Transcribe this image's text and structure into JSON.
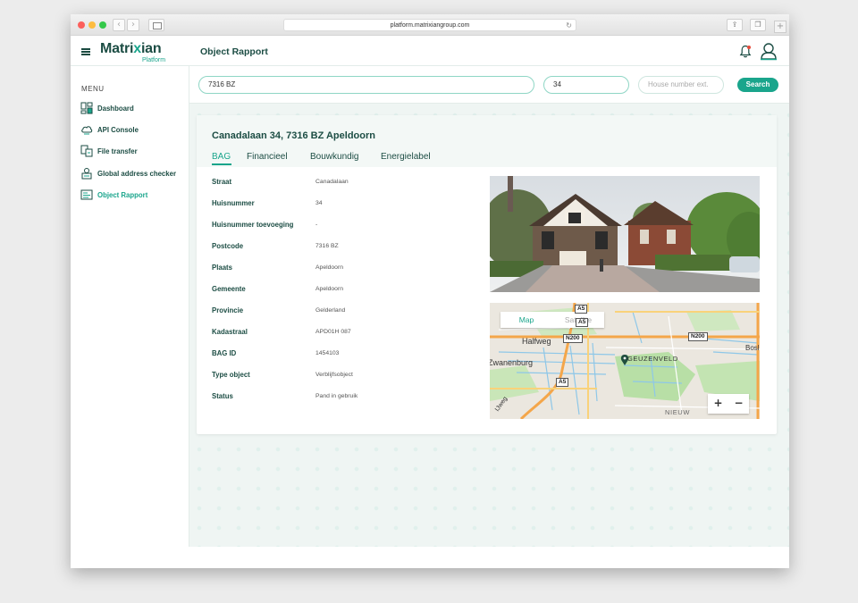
{
  "browser": {
    "url": "platform.matrixiangroup.com"
  },
  "app": {
    "logo_main_a": "Matri",
    "logo_main_x": "x",
    "logo_main_b": "ian",
    "logo_sub": "Platform",
    "page_title": "Object Rapport"
  },
  "sidebar": {
    "menu_label": "MENU",
    "items": [
      {
        "label": "Dashboard",
        "icon": "dashboard-icon"
      },
      {
        "label": "API Console",
        "icon": "cloud-icon"
      },
      {
        "label": "File transfer",
        "icon": "file-transfer-icon"
      },
      {
        "label": "Global address checker",
        "icon": "address-checker-icon"
      },
      {
        "label": "Object Rapport",
        "icon": "report-icon",
        "active": true
      }
    ]
  },
  "search": {
    "postcode_value": "7316 BZ",
    "house_number_value": "34",
    "extension_placeholder": "House number ext.",
    "button_label": "Search"
  },
  "report": {
    "address": "Canadalaan 34, 7316 BZ Apeldoorn",
    "tabs": [
      "BAG",
      "Financieel",
      "Bouwkundig",
      "Energielabel"
    ],
    "active_tab": "BAG",
    "fields": [
      {
        "label": "Straat",
        "value": "Canadalaan"
      },
      {
        "label": "Huisnummer",
        "value": "34"
      },
      {
        "label": "Huisnummer toevoeging",
        "value": "-"
      },
      {
        "label": "Postcode",
        "value": "7316 BZ"
      },
      {
        "label": "Plaats",
        "value": "Apeldoorn"
      },
      {
        "label": "Gemeente",
        "value": "Apeldoorn"
      },
      {
        "label": "Provincie",
        "value": "Gelderland"
      },
      {
        "label": "Kadastraal",
        "value": "APD01H 087"
      },
      {
        "label": "BAG ID",
        "value": "1454103"
      },
      {
        "label": "Type object",
        "value": "Verblijfsobject"
      },
      {
        "label": "Status",
        "value": "Pand in gebruik"
      }
    ]
  },
  "map": {
    "tab_map": "Map",
    "tab_satellite": "Satellite",
    "zoom_in": "+",
    "zoom_out": "−",
    "labels": {
      "halfweg": "Halfweg",
      "zwanenburg": "Zwanenburg",
      "geuzenveld": "GEUZENVELD",
      "bos": "Bosl",
      "nieuw": "NIEUW",
      "ijweg": "IJweg"
    },
    "shields": {
      "a5_top": "A5",
      "a5_mid": "A5",
      "a5_bottom": "A5",
      "n200_left": "N200",
      "n200_right": "N200"
    }
  },
  "colors": {
    "brand": "#1aa58c",
    "brand_dark": "#1c4d44"
  }
}
